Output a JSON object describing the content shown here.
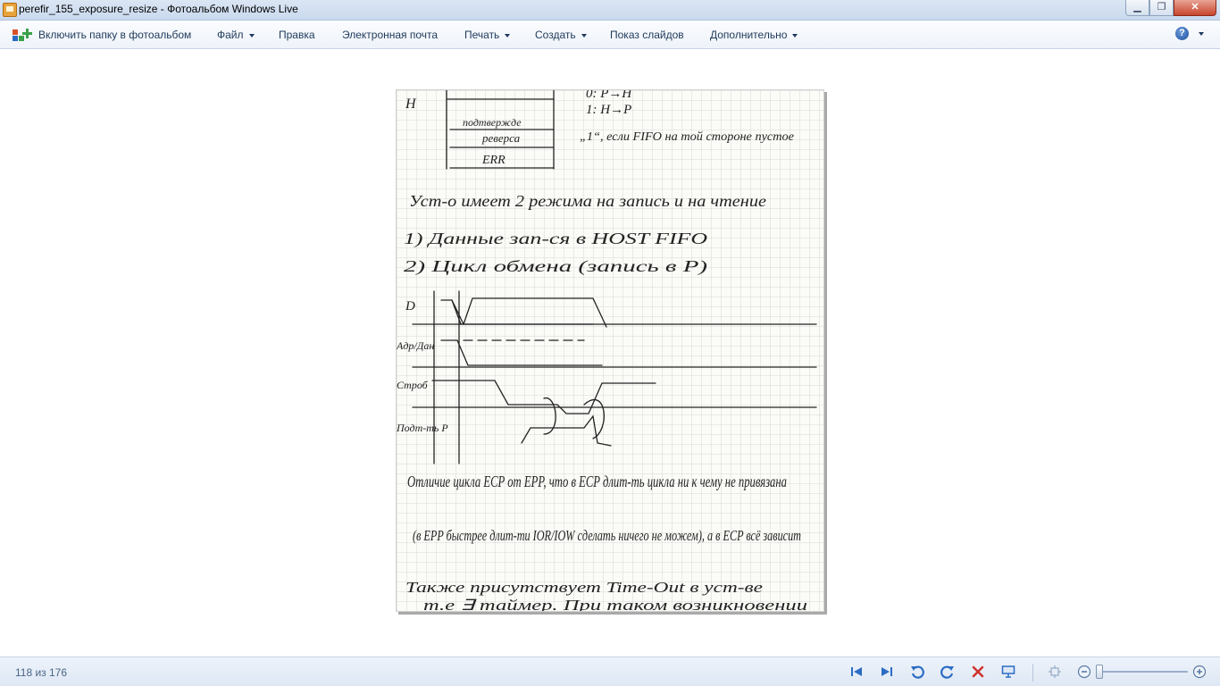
{
  "window": {
    "title": "perefir_155_exposure_resize - Фотоальбом Windows Live",
    "minimize_label": "▁",
    "maximize_label": "❐",
    "close_label": "✕"
  },
  "menu": {
    "include_folder": "Включить папку в фотоальбом",
    "file": "Файл",
    "edit": "Правка",
    "email": "Электронная почта",
    "print": "Печать",
    "create": "Создать",
    "slideshow": "Показ слайдов",
    "extras": "Дополнительно",
    "help_icon": "?"
  },
  "photo": {
    "handwritten_lines": [
      "подтвержде",
      "реверса",
      "ERR",
      "0: P→H",
      "1: H→P",
      "„1“, если FIFO на той стороне пустое",
      "Уст-о имеет 2 режима на запись и на чтение",
      "1) Данные зап-ся в HOST FIFO",
      "2) Цикл обмена (запись в Р)",
      "Отличие цикла ECP от EPP, что в ECP длит-ть цикла ни к чему не привязана",
      "(в EPP быстрее длит-ти IOR/IOW сделать ничего не можем), а в ECP всё зависит",
      "Также присутствует Time-Out в уст-ве",
      "т.е ∃ таймер. При таком возникновении"
    ],
    "signal_labels": [
      "D",
      "Адр/Дан",
      "Строб",
      "Подт-ть P"
    ],
    "side_label": "H"
  },
  "status": {
    "counter": "118 из 176"
  },
  "icons": {
    "folder_add": "folder-add-icon",
    "prev": "previous-icon",
    "next": "next-icon",
    "rotate_left": "rotate-left-icon",
    "rotate_right": "rotate-right-icon",
    "delete": "delete-icon",
    "slideshow": "slideshow-icon",
    "fit": "fit-to-window-icon",
    "zoom_out": "zoom-out-icon",
    "zoom_in": "zoom-in-icon"
  },
  "colors": {
    "accent_blue": "#2b6cc4",
    "delete_red": "#d0312d"
  }
}
